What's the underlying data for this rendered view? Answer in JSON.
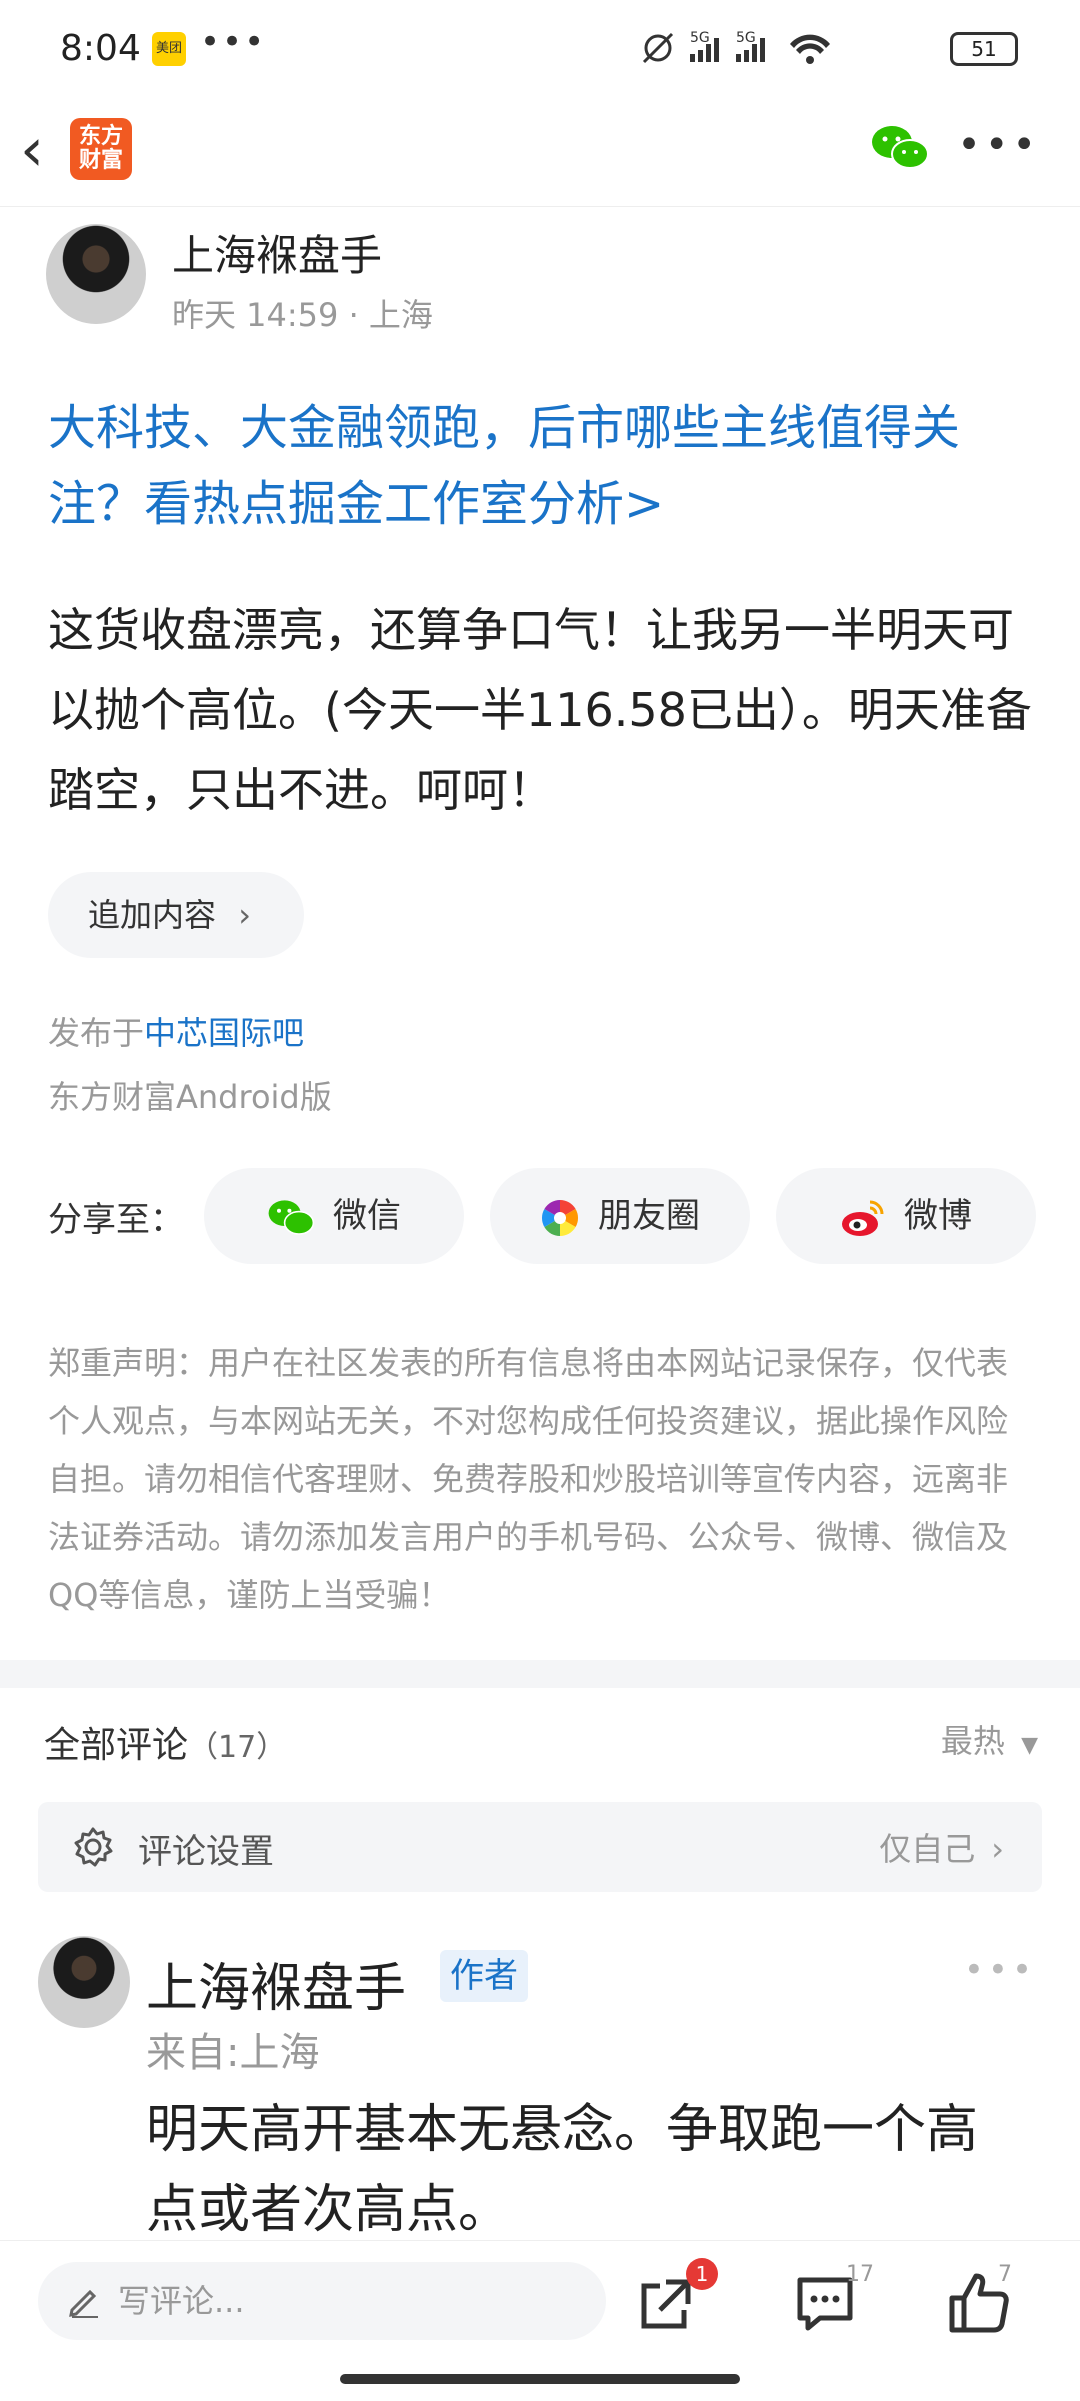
{
  "status_bar": {
    "time": "8:04",
    "app_badge": "美团",
    "battery": "51"
  },
  "nav": {
    "logo_line1": "东方",
    "logo_line2": "财富"
  },
  "post": {
    "author": "上海褓盘手",
    "meta": "昨天 14:59 · 上海",
    "headline": "大科技、大金融领跑，后市哪些主线值得关注？看热点掘金工作室分析>",
    "body": "这货收盘漂亮，还算争口气！让我另一半明天可以抛个高位。(今天一半116.58已出）。明天准备踏空，只出不进。呵呵！",
    "add_content_label": "追加内容",
    "published_prefix": "发布于",
    "published_forum": "中芯国际吧",
    "client": "东方财富Android版"
  },
  "share": {
    "label": "分享至：",
    "wechat": "微信",
    "moments": "朋友圈",
    "weibo": "微博"
  },
  "disclaimer": "郑重声明：用户在社区发表的所有信息将由本网站记录保存，仅代表个人观点，与本网站无关，不对您构成任何投资建议，据此操作风险自担。请勿相信代客理财、免费荐股和炒股培训等宣传内容，远离非法证券活动。请勿添加发言用户的手机号码、公众号、微博、微信及QQ等信息，谨防上当受骗！",
  "comments": {
    "title": "全部评论",
    "count": "（17）",
    "sort": "最热",
    "setting_label": "评论设置",
    "setting_value": "仅自己",
    "first": {
      "name": "上海褓盘手",
      "tag": "作者",
      "from": "来自:上海",
      "text": "明天高开基本无悬念。争取跑一个高点或者次高点。"
    }
  },
  "bottom_bar": {
    "write_placeholder": "写评论...",
    "share_badge": "1",
    "comment_count": "17",
    "like_count": "7"
  },
  "colors": {
    "link": "#1a73c8",
    "accent": "#f15a22",
    "wechat": "#2dc100"
  }
}
